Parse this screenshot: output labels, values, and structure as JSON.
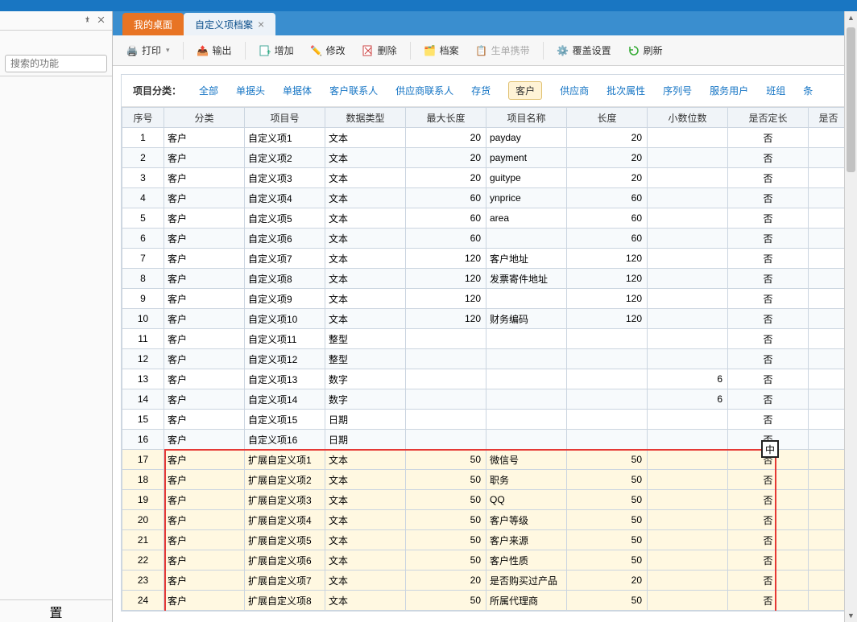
{
  "sidebar": {
    "search_placeholder": "搜索的功能",
    "bottom_label": "置"
  },
  "tabs": {
    "desktop": "我的桌面",
    "current": "自定义项档案"
  },
  "toolbar": {
    "print": "打印",
    "export": "输出",
    "add": "增加",
    "edit": "修改",
    "delete": "删除",
    "archive": "档案",
    "carry": "生单携带",
    "override": "覆盖设置",
    "refresh": "刷新"
  },
  "filter": {
    "label": "项目分类：",
    "items": [
      "全部",
      "单据头",
      "单据体",
      "客户联系人",
      "供应商联系人",
      "存货",
      "客户",
      "供应商",
      "批次属性",
      "序列号",
      "服务用户",
      "班组",
      "条"
    ]
  },
  "columns": [
    "序号",
    "分类",
    "项目号",
    "数据类型",
    "最大长度",
    "项目名称",
    "长度",
    "小数位数",
    "是否定长",
    "是否"
  ],
  "rows": [
    {
      "seq": "1",
      "cat": "客户",
      "item": "自定义项1",
      "dtype": "文本",
      "maxlen": "20",
      "name": "payday",
      "len": "20",
      "dec": "",
      "fixed": "否"
    },
    {
      "seq": "2",
      "cat": "客户",
      "item": "自定义项2",
      "dtype": "文本",
      "maxlen": "20",
      "name": "payment",
      "len": "20",
      "dec": "",
      "fixed": "否"
    },
    {
      "seq": "3",
      "cat": "客户",
      "item": "自定义项3",
      "dtype": "文本",
      "maxlen": "20",
      "name": "guitype",
      "len": "20",
      "dec": "",
      "fixed": "否"
    },
    {
      "seq": "4",
      "cat": "客户",
      "item": "自定义项4",
      "dtype": "文本",
      "maxlen": "60",
      "name": "ynprice",
      "len": "60",
      "dec": "",
      "fixed": "否"
    },
    {
      "seq": "5",
      "cat": "客户",
      "item": "自定义项5",
      "dtype": "文本",
      "maxlen": "60",
      "name": "area",
      "len": "60",
      "dec": "",
      "fixed": "否"
    },
    {
      "seq": "6",
      "cat": "客户",
      "item": "自定义项6",
      "dtype": "文本",
      "maxlen": "60",
      "name": "",
      "len": "60",
      "dec": "",
      "fixed": "否"
    },
    {
      "seq": "7",
      "cat": "客户",
      "item": "自定义项7",
      "dtype": "文本",
      "maxlen": "120",
      "name": "客户地址",
      "len": "120",
      "dec": "",
      "fixed": "否"
    },
    {
      "seq": "8",
      "cat": "客户",
      "item": "自定义项8",
      "dtype": "文本",
      "maxlen": "120",
      "name": "发票寄件地址",
      "len": "120",
      "dec": "",
      "fixed": "否"
    },
    {
      "seq": "9",
      "cat": "客户",
      "item": "自定义项9",
      "dtype": "文本",
      "maxlen": "120",
      "name": "",
      "len": "120",
      "dec": "",
      "fixed": "否"
    },
    {
      "seq": "10",
      "cat": "客户",
      "item": "自定义项10",
      "dtype": "文本",
      "maxlen": "120",
      "name": "财务编码",
      "len": "120",
      "dec": "",
      "fixed": "否"
    },
    {
      "seq": "11",
      "cat": "客户",
      "item": "自定义项11",
      "dtype": "整型",
      "maxlen": "",
      "name": "",
      "len": "",
      "dec": "",
      "fixed": "否"
    },
    {
      "seq": "12",
      "cat": "客户",
      "item": "自定义项12",
      "dtype": "整型",
      "maxlen": "",
      "name": "",
      "len": "",
      "dec": "",
      "fixed": "否"
    },
    {
      "seq": "13",
      "cat": "客户",
      "item": "自定义项13",
      "dtype": "数字",
      "maxlen": "",
      "name": "",
      "len": "",
      "dec": "6",
      "fixed": "否"
    },
    {
      "seq": "14",
      "cat": "客户",
      "item": "自定义项14",
      "dtype": "数字",
      "maxlen": "",
      "name": "",
      "len": "",
      "dec": "6",
      "fixed": "否"
    },
    {
      "seq": "15",
      "cat": "客户",
      "item": "自定义项15",
      "dtype": "日期",
      "maxlen": "",
      "name": "",
      "len": "",
      "dec": "",
      "fixed": "否"
    },
    {
      "seq": "16",
      "cat": "客户",
      "item": "自定义项16",
      "dtype": "日期",
      "maxlen": "",
      "name": "",
      "len": "",
      "dec": "",
      "fixed": "否"
    },
    {
      "seq": "17",
      "cat": "客户",
      "item": "扩展自定义项1",
      "dtype": "文本",
      "maxlen": "50",
      "name": "微信号",
      "len": "50",
      "dec": "",
      "fixed": "否",
      "hl": true
    },
    {
      "seq": "18",
      "cat": "客户",
      "item": "扩展自定义项2",
      "dtype": "文本",
      "maxlen": "50",
      "name": "职务",
      "len": "50",
      "dec": "",
      "fixed": "否",
      "hl": true
    },
    {
      "seq": "19",
      "cat": "客户",
      "item": "扩展自定义项3",
      "dtype": "文本",
      "maxlen": "50",
      "name": "QQ",
      "len": "50",
      "dec": "",
      "fixed": "否",
      "hl": true
    },
    {
      "seq": "20",
      "cat": "客户",
      "item": "扩展自定义项4",
      "dtype": "文本",
      "maxlen": "50",
      "name": "客户等级",
      "len": "50",
      "dec": "",
      "fixed": "否",
      "hl": true
    },
    {
      "seq": "21",
      "cat": "客户",
      "item": "扩展自定义项5",
      "dtype": "文本",
      "maxlen": "50",
      "name": "客户来源",
      "len": "50",
      "dec": "",
      "fixed": "否",
      "hl": true
    },
    {
      "seq": "22",
      "cat": "客户",
      "item": "扩展自定义项6",
      "dtype": "文本",
      "maxlen": "50",
      "name": "客户性质",
      "len": "50",
      "dec": "",
      "fixed": "否",
      "hl": true
    },
    {
      "seq": "23",
      "cat": "客户",
      "item": "扩展自定义项7",
      "dtype": "文本",
      "maxlen": "20",
      "name": "是否购买过产品",
      "len": "20",
      "dec": "",
      "fixed": "否",
      "hl": true
    },
    {
      "seq": "24",
      "cat": "客户",
      "item": "扩展自定义项8",
      "dtype": "文本",
      "maxlen": "50",
      "name": "所属代理商",
      "len": "50",
      "dec": "",
      "fixed": "否",
      "hl": true
    }
  ],
  "cursor_char": "中"
}
